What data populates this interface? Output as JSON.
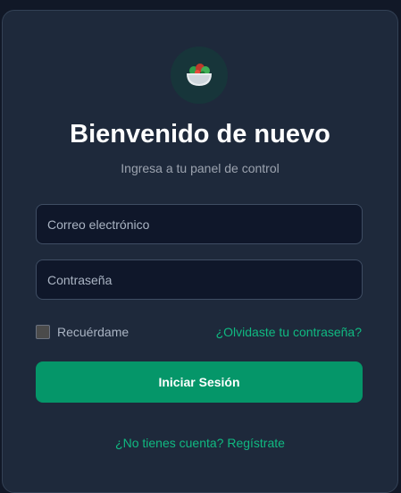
{
  "login": {
    "logo_icon": "salad-bowl-icon",
    "title": "Bienvenido de nuevo",
    "subtitle": "Ingresa a tu panel de control",
    "email_placeholder": "Correo electrónico",
    "email_value": "",
    "password_placeholder": "Contraseña",
    "password_value": "",
    "remember_label": "Recuérdame",
    "remember_checked": false,
    "forgot_link": "¿Olvidaste tu contraseña?",
    "submit_label": "Iniciar Sesión",
    "signup_link": "¿No tienes cuenta? Regístrate"
  },
  "colors": {
    "page_background": "#111827",
    "card_background": "#1e293b",
    "input_background": "#0f172a",
    "accent": "#10b981",
    "button": "#059669",
    "text_muted": "#9ca3af"
  }
}
